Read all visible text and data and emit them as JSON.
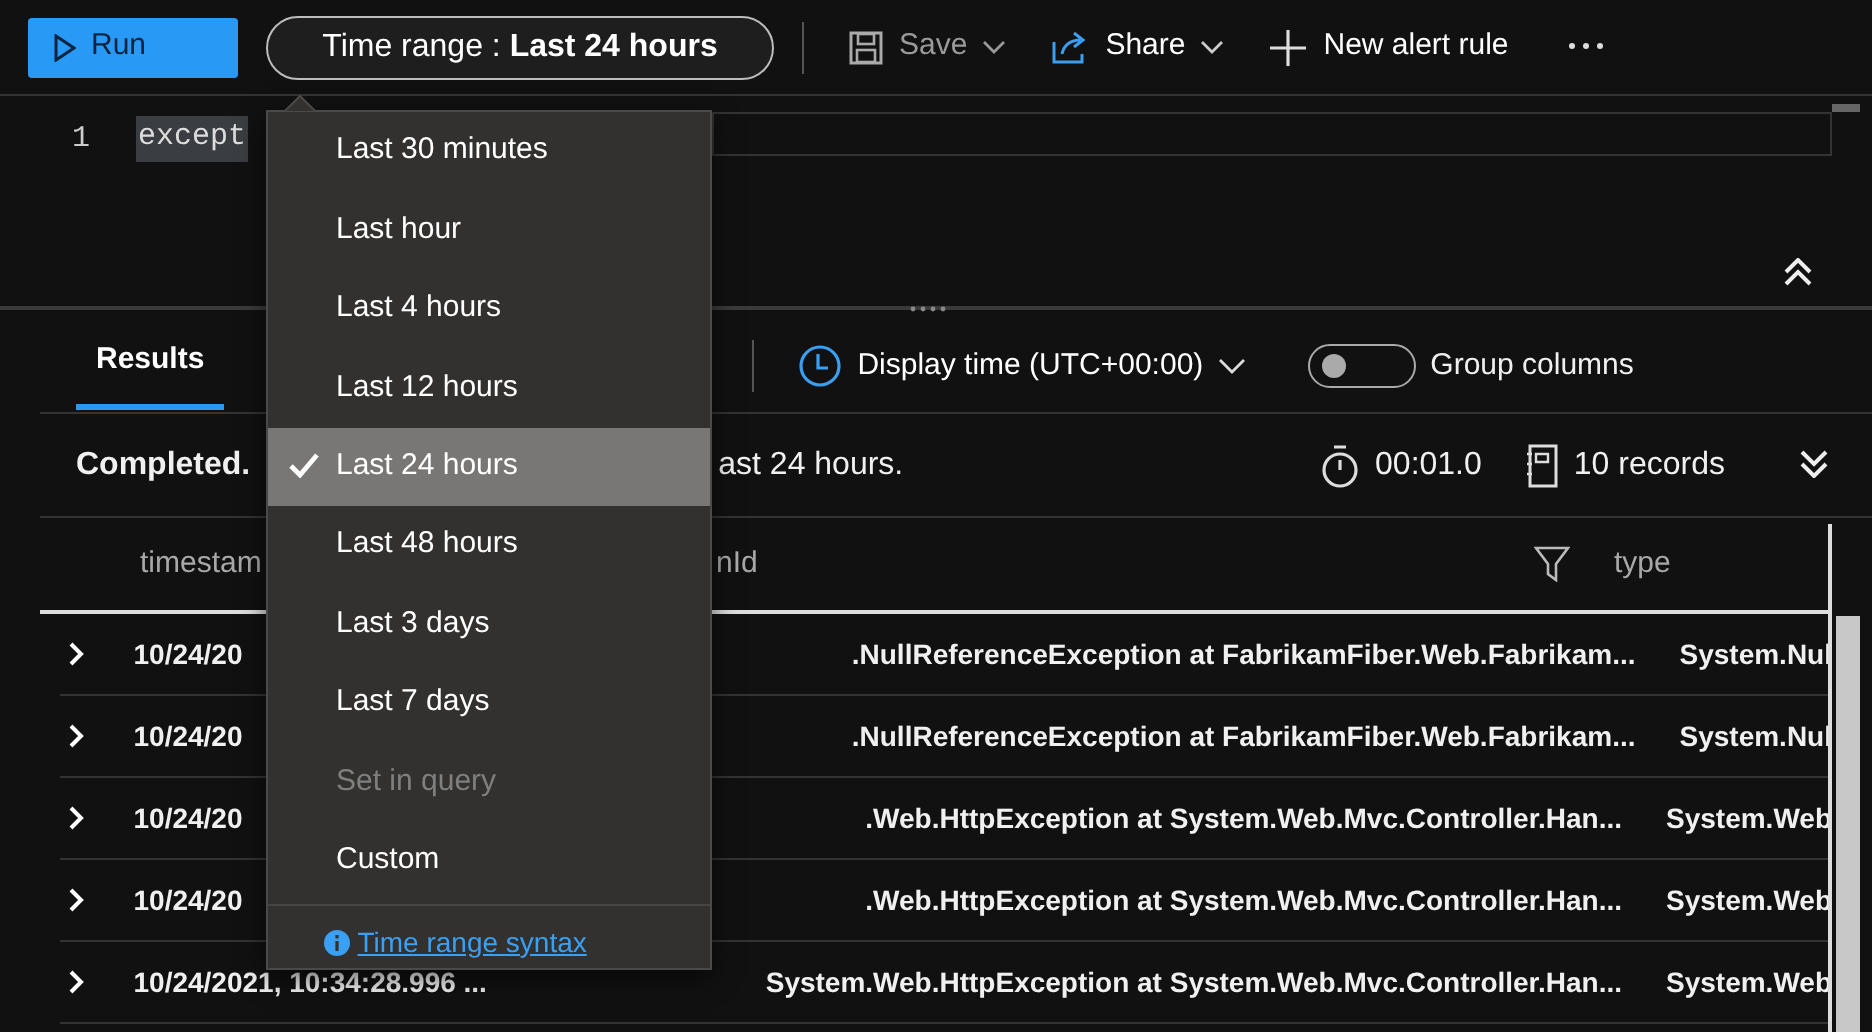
{
  "toolbar": {
    "run": {
      "label": "Run"
    },
    "time_range": {
      "label": "Time range :",
      "value": "Last 24 hours",
      "expanded": true
    },
    "actions": [
      {
        "kind": "save",
        "label": "Save",
        "disabled": true,
        "menu": true
      },
      {
        "kind": "share",
        "label": "Share",
        "disabled": false,
        "menu": true
      },
      {
        "kind": "add",
        "label": "New alert rule",
        "disabled": false,
        "menu": false
      },
      {
        "kind": "more"
      }
    ]
  },
  "editor": {
    "line_number": "1",
    "code": "except"
  },
  "time_menu": {
    "items": [
      {
        "label": "Last 30 minutes",
        "selected": false,
        "disabled": false
      },
      {
        "label": "Last hour",
        "selected": false,
        "disabled": false
      },
      {
        "label": "Last 4 hours",
        "selected": false,
        "disabled": false
      },
      {
        "label": "Last 12 hours",
        "selected": false,
        "disabled": false
      },
      {
        "label": "Last 24 hours",
        "selected": true,
        "disabled": false
      },
      {
        "label": "Last 48 hours",
        "selected": false,
        "disabled": false
      },
      {
        "label": "Last 3 days",
        "selected": false,
        "disabled": false
      },
      {
        "label": "Last 7 days",
        "selected": false,
        "disabled": false
      },
      {
        "label": "Set in query",
        "selected": false,
        "disabled": true
      },
      {
        "label": "Custom",
        "selected": false,
        "disabled": false
      }
    ],
    "footer_link": "Time range syntax"
  },
  "results": {
    "tabs": [
      {
        "label": "Results",
        "selected": true
      }
    ],
    "display_time": "Display time (UTC+00:00)",
    "group_columns": {
      "label": "Group columns",
      "on": false
    },
    "status": "Completed.",
    "status_tail": "ast 24 hours.",
    "duration": "00:01.0",
    "records": "10 records"
  },
  "table": {
    "columns": [
      "timestam",
      "nId",
      "type"
    ],
    "rows": [
      [
        "10/24/20",
        ".NullReferenceException at FabrikamFiber.Web.Fabrikam...",
        "System.Nul"
      ],
      [
        "10/24/20",
        ".NullReferenceException at FabrikamFiber.Web.Fabrikam...",
        "System.Nul"
      ],
      [
        "10/24/20",
        ".Web.HttpException at System.Web.Mvc.Controller.Han...",
        "System.Web"
      ],
      [
        "10/24/20",
        ".Web.HttpException at System.Web.Mvc.Controller.Han...",
        "System.Web"
      ],
      [
        "10/24/2021, 10:34:28.996 ...",
        "System.Web.HttpException at System.Web.Mvc.Controller.Han...",
        "System.Web"
      ]
    ]
  }
}
